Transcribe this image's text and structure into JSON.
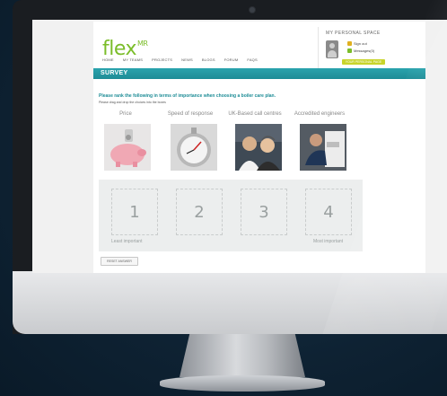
{
  "brand": {
    "name": "flex",
    "superscript": "MR"
  },
  "nav": [
    "HOME",
    "MY TEAMS",
    "PROJECTS",
    "NEWS",
    "BLOGS",
    "FORUM",
    "FAQS"
  ],
  "personal": {
    "title": "MY PERSONAL SPACE",
    "signout": "Sign out",
    "messages": "Messages(0)",
    "button": "YOUR PERSONAL PAGE"
  },
  "survey": {
    "title": "SURVEY",
    "question": "Please rank the following in terms of importance when choosing a boiler care plan.",
    "instruction": "Please drag and drop the choices into the boxes",
    "options": [
      "Price",
      "Speed of response",
      "UK-Based call centres",
      "Accredited engineers"
    ],
    "slots": [
      "1",
      "2",
      "3",
      "4"
    ],
    "left_label": "Least important",
    "right_label": "Most important",
    "reset_label": "RESET ANSWER"
  }
}
